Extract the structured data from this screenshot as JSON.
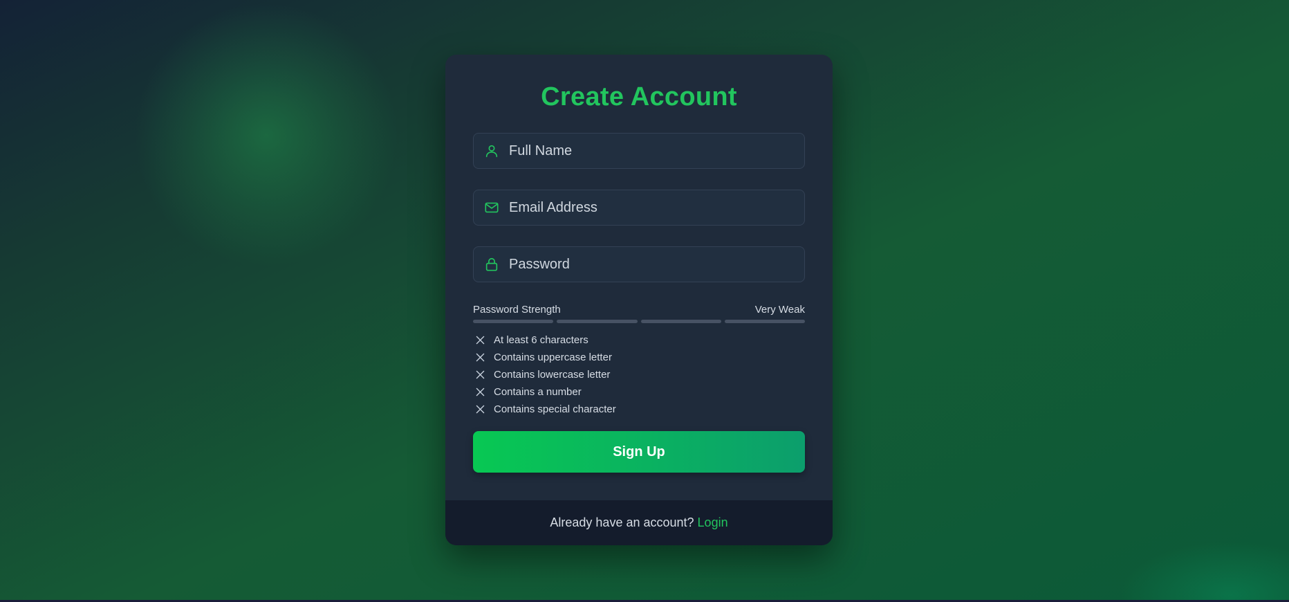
{
  "form": {
    "title": "Create Account",
    "full_name": {
      "placeholder": "Full Name",
      "value": "",
      "icon": "user-icon"
    },
    "email": {
      "placeholder": "Email Address",
      "value": "",
      "icon": "mail-icon"
    },
    "password": {
      "placeholder": "Password",
      "value": "",
      "icon": "lock-icon"
    }
  },
  "strength": {
    "label": "Password Strength",
    "level": "Very Weak",
    "segments_filled": 0,
    "segments_total": 4
  },
  "requirements": [
    {
      "label": "At least 6 characters",
      "met": false
    },
    {
      "label": "Contains uppercase letter",
      "met": false
    },
    {
      "label": "Contains lowercase letter",
      "met": false
    },
    {
      "label": "Contains a number",
      "met": false
    },
    {
      "label": "Contains special character",
      "met": false
    }
  ],
  "signup_label": "Sign Up",
  "footer": {
    "prompt": "Already have an account?",
    "link": "Login"
  },
  "colors": {
    "accent": "#22c55e",
    "card": "#1f2b3b",
    "footer": "#141c2c",
    "button_start": "#08c853",
    "button_end": "#0c9e6c"
  }
}
